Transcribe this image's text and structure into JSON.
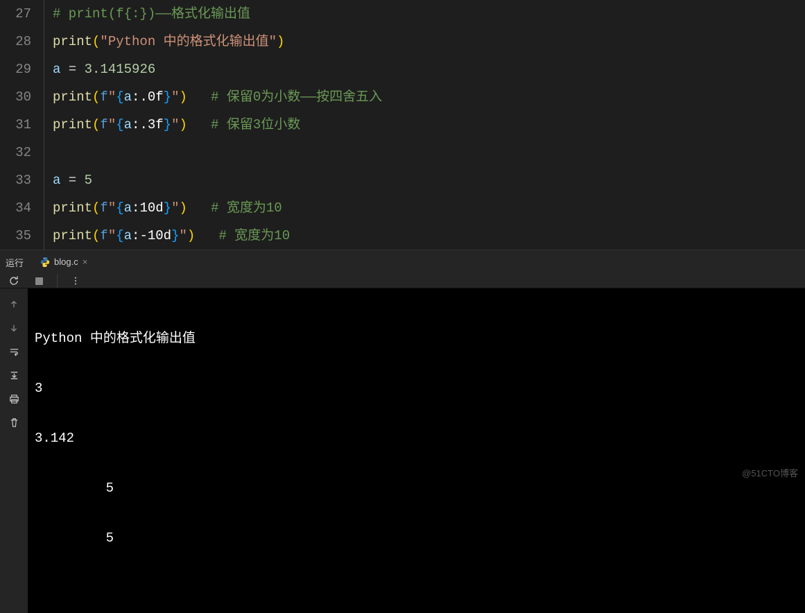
{
  "gutter": [
    "27",
    "28",
    "29",
    "30",
    "31",
    "32",
    "33",
    "34",
    "35"
  ],
  "lines": {
    "l27": {
      "comment": "# print(f{:})——格式化输出值"
    },
    "l28": {
      "func": "print",
      "str1": "\"Python 中的格式化输出值\""
    },
    "l29": {
      "var": "a",
      "eq": " = ",
      "num": "3.1415926"
    },
    "l30": {
      "func": "print",
      "prefix": "f",
      "q1": "\"",
      "lb": "{",
      "var": "a",
      "fmt": ":.0f",
      "rb": "}",
      "q2": "\"",
      "pad": "   ",
      "comment": "# 保留0为小数——按四舍五入"
    },
    "l31": {
      "func": "print",
      "prefix": "f",
      "q1": "\"",
      "lb": "{",
      "var": "a",
      "fmt": ":.3f",
      "rb": "}",
      "q2": "\"",
      "pad": "   ",
      "comment": "# 保留3位小数"
    },
    "l33": {
      "var": "a",
      "eq": " = ",
      "num": "5"
    },
    "l34": {
      "func": "print",
      "prefix": "f",
      "q1": "\"",
      "lb": "{",
      "var": "a",
      "fmt": ":10d",
      "rb": "}",
      "q2": "\"",
      "pad": "   ",
      "comment": "# 宽度为10"
    },
    "l35": {
      "func": "print",
      "prefix": "f",
      "q1": "\"",
      "lb": "{",
      "var": "a",
      "fmt": ":-10d",
      "rb": "}",
      "q2": "\"",
      "pad": "   ",
      "comment": "# 宽度为10"
    }
  },
  "panel": {
    "run_label": "运行",
    "file_name": "blog.c",
    "close_x": "×"
  },
  "terminal": {
    "lines": [
      "Python 中的格式化输出值",
      "3",
      "3.142",
      "         5",
      "         5"
    ]
  },
  "watermark": "@51CTO博客"
}
